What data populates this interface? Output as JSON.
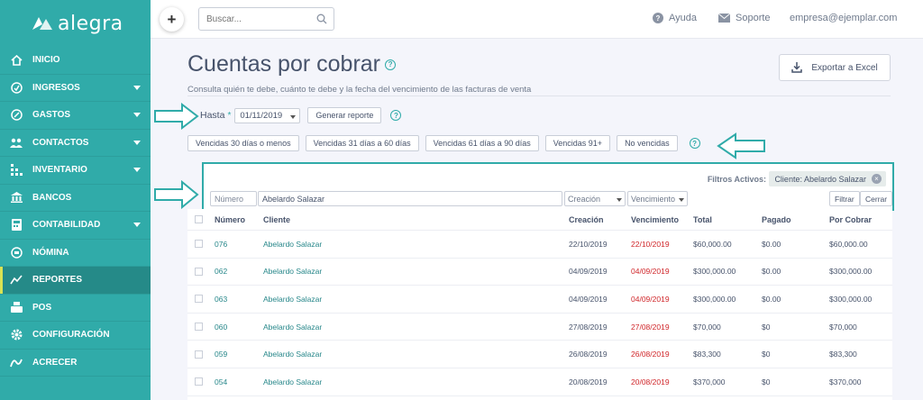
{
  "brand": {
    "name": "alegra",
    "accent": "#30aba9",
    "sidebar_active": "#258a88",
    "active_bar": "#d9e354"
  },
  "sidebar": {
    "items": [
      {
        "label": "INICIO",
        "icon": "home-icon",
        "caret": false,
        "active": false
      },
      {
        "label": "INGRESOS",
        "icon": "income-icon",
        "caret": true,
        "active": false
      },
      {
        "label": "GASTOS",
        "icon": "expense-icon",
        "caret": true,
        "active": false
      },
      {
        "label": "CONTACTOS",
        "icon": "contacts-icon",
        "caret": true,
        "active": false
      },
      {
        "label": "INVENTARIO",
        "icon": "inventory-icon",
        "caret": true,
        "active": false
      },
      {
        "label": "BANCOS",
        "icon": "bank-icon",
        "caret": false,
        "active": false
      },
      {
        "label": "CONTABILIDAD",
        "icon": "accounting-icon",
        "caret": true,
        "active": false
      },
      {
        "label": "NÓMINA",
        "icon": "payroll-icon",
        "caret": false,
        "active": false
      },
      {
        "label": "REPORTES",
        "icon": "reports-icon",
        "caret": false,
        "active": true
      },
      {
        "label": "POS",
        "icon": "pos-icon",
        "caret": false,
        "active": false
      },
      {
        "label": "CONFIGURACIÓN",
        "icon": "gear-icon",
        "caret": false,
        "active": false
      },
      {
        "label": "ACRECER",
        "icon": "acrecer-icon",
        "caret": false,
        "active": false
      }
    ]
  },
  "topbar": {
    "search_placeholder": "Buscar...",
    "help_label": "Ayuda",
    "support_label": "Soporte",
    "user_email": "empresa@ejemplar.com"
  },
  "page": {
    "title": "Cuentas por cobrar",
    "subtitle": "Consulta quién te debe, cuánto te debe y la fecha del vencimiento de las facturas de venta",
    "export_label": "Exportar a Excel",
    "hasta_label": "Hasta",
    "required_mark": "*",
    "hasta_date": "01/11/2019",
    "generate_label": "Generar reporte",
    "help_mark": "?"
  },
  "chips": [
    "Vencidas 30 días o menos",
    "Vencidas 31 días a 60 días",
    "Vencidas 61 días a 90 días",
    "Vencidas 91+",
    "No vencidas"
  ],
  "filters": {
    "active_label": "Filtros Activos:",
    "active_chip": "Cliente: Abelardo Salazar",
    "numero_placeholder": "Número",
    "cliente_value": "Abelardo Salazar",
    "creacion_label": "Creación",
    "vencimiento_label": "Vencimiento",
    "filter_button": "Filtrar",
    "close_button": "Cerrar"
  },
  "table": {
    "headers": [
      "Número",
      "Cliente",
      "Creación",
      "Vencimiento",
      "Total",
      "Pagado",
      "Por Cobrar"
    ],
    "rows": [
      [
        "076",
        "Abelardo Salazar",
        "22/10/2019",
        "22/10/2019",
        "$60,000.00",
        "$0.00",
        "$60,000.00"
      ],
      [
        "062",
        "Abelardo Salazar",
        "04/09/2019",
        "04/09/2019",
        "$300,000.00",
        "$0.00",
        "$300,000.00"
      ],
      [
        "063",
        "Abelardo Salazar",
        "04/09/2019",
        "04/09/2019",
        "$300,000.00",
        "$0.00",
        "$300,000.00"
      ],
      [
        "060",
        "Abelardo Salazar",
        "27/08/2019",
        "27/08/2019",
        "$70,000",
        "$0",
        "$70,000"
      ],
      [
        "059",
        "Abelardo Salazar",
        "26/08/2019",
        "26/08/2019",
        "$83,300",
        "$0",
        "$83,300"
      ],
      [
        "054",
        "Abelardo Salazar",
        "20/08/2019",
        "20/08/2019",
        "$370,000",
        "$0",
        "$370,000"
      ]
    ]
  }
}
